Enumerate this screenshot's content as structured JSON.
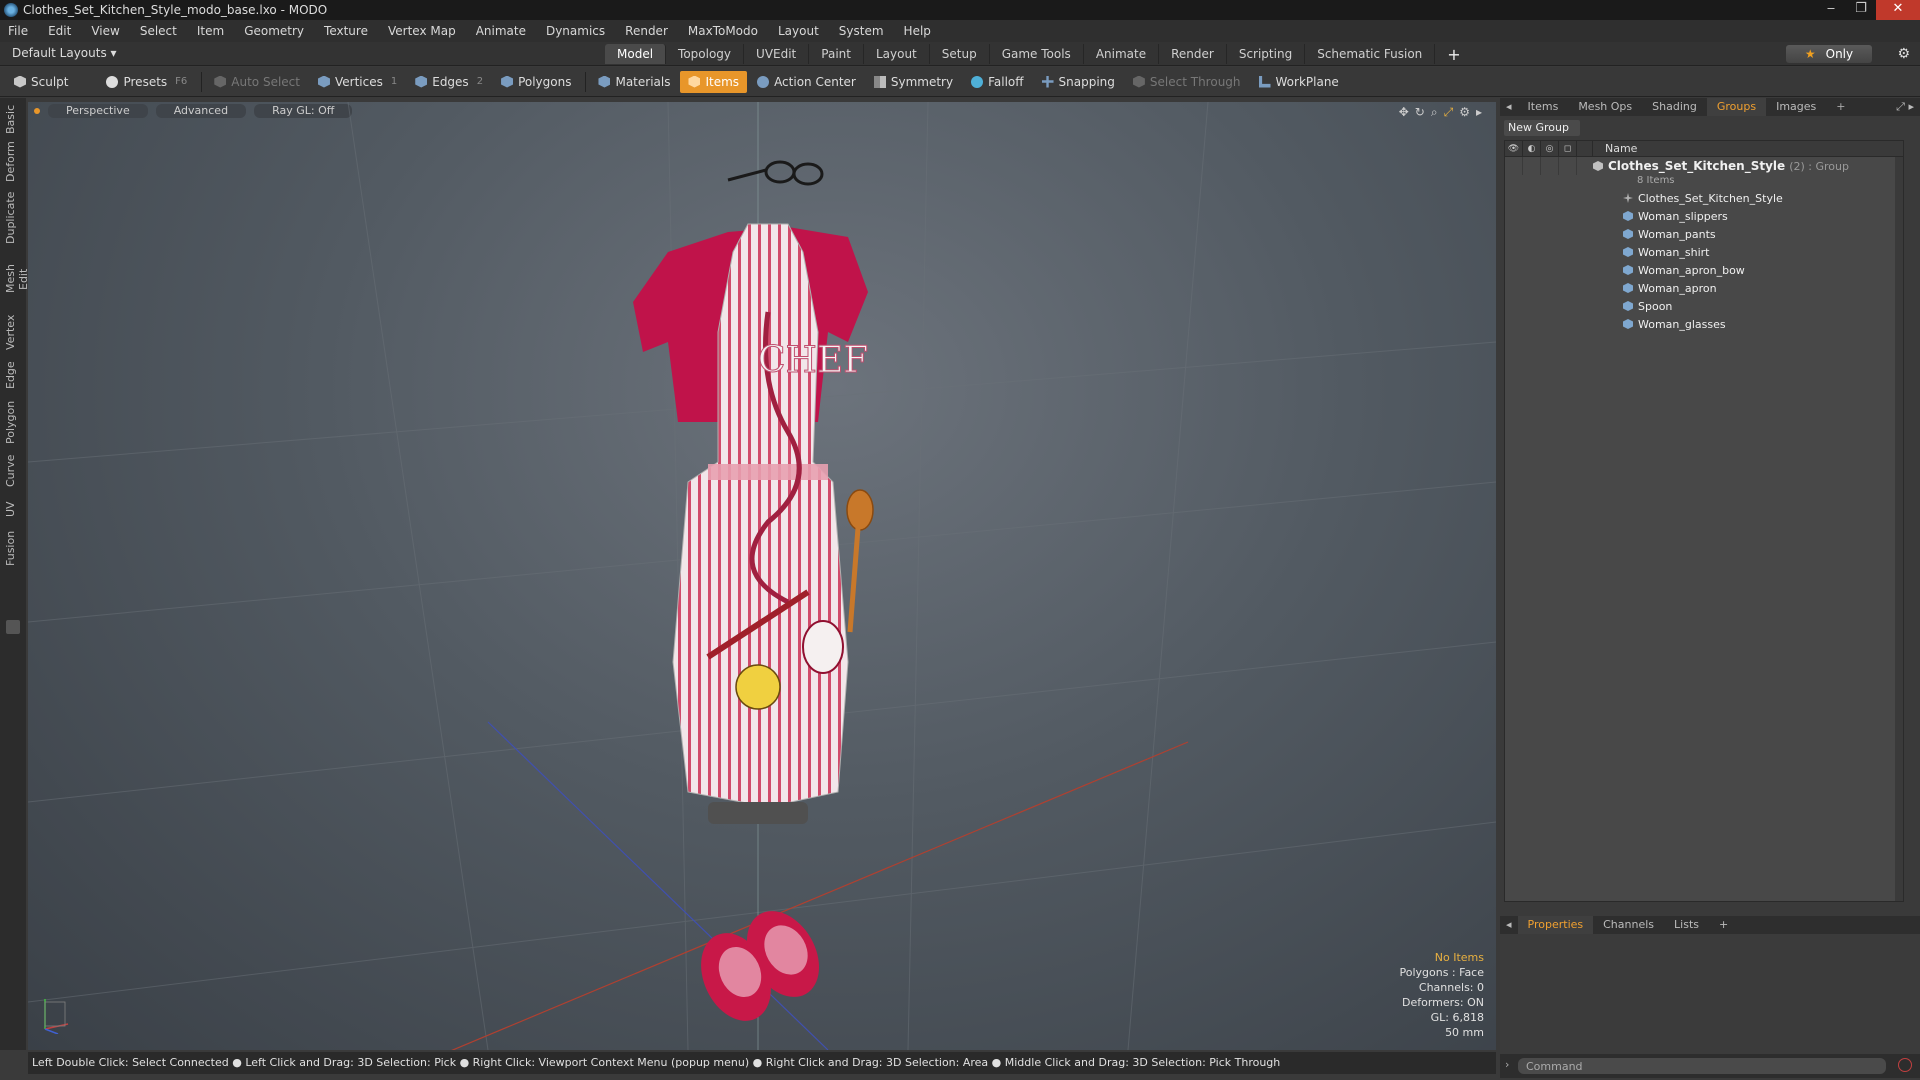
{
  "window": {
    "title": "Clothes_Set_Kitchen_Style_modo_base.lxo - MODO"
  },
  "menu": [
    "File",
    "Edit",
    "View",
    "Select",
    "Item",
    "Geometry",
    "Texture",
    "Vertex Map",
    "Animate",
    "Dynamics",
    "Render",
    "MaxToModo",
    "Layout",
    "System",
    "Help"
  ],
  "layouts": {
    "label": "Default Layouts ▾"
  },
  "tabs": [
    "Model",
    "Topology",
    "UVEdit",
    "Paint",
    "Layout",
    "Setup",
    "Game Tools",
    "Animate",
    "Render",
    "Scripting",
    "Schematic Fusion"
  ],
  "active_tab": "Model",
  "only_label": "Only",
  "toolbar": {
    "sculpt": "Sculpt",
    "presets": "Presets",
    "presets_key": "F6",
    "auto_select": "Auto Select",
    "vertices": "Vertices",
    "vertices_count": "1",
    "edges": "Edges",
    "edges_count": "2",
    "polygons": "Polygons",
    "materials": "Materials",
    "items": "Items",
    "action_center": "Action Center",
    "symmetry": "Symmetry",
    "falloff": "Falloff",
    "snapping": "Snapping",
    "select_through": "Select Through",
    "workplane": "WorkPlane"
  },
  "left_tabs": [
    "Basic",
    "Deform",
    "Duplicate",
    "Mesh Edit",
    "Vertex",
    "Edge",
    "Polygon",
    "Curve",
    "UV",
    "Fusion"
  ],
  "viewport": {
    "view": "Perspective",
    "shading": "Advanced",
    "raygl": "Ray GL: Off",
    "info": {
      "items": "No Items",
      "polygons": "Polygons : Face",
      "channels": "Channels: 0",
      "deformers": "Deformers: ON",
      "gl": "GL: 6,818",
      "focal": "50 mm"
    }
  },
  "status": "Left Double Click: Select Connected ● Left Click and Drag: 3D Selection: Pick ● Right Click: Viewport Context Menu (popup menu) ● Right Click and Drag: 3D Selection: Area ● Middle Click and Drag: 3D Selection: Pick Through",
  "panel": {
    "tabs": [
      "Items",
      "Mesh Ops",
      "Shading",
      "Groups",
      "Images"
    ],
    "active": "Groups",
    "new_group": "New Group",
    "column_name": "Name",
    "group": {
      "name": "Clothes_Set_Kitchen_Style",
      "suffix": "(2) : Group",
      "count": "8 Items"
    },
    "items": [
      "Clothes_Set_Kitchen_Style",
      "Woman_slippers",
      "Woman_pants",
      "Woman_shirt",
      "Woman_apron_bow",
      "Woman_apron",
      "Spoon",
      "Woman_glasses"
    ]
  },
  "properties": {
    "tabs": [
      "Properties",
      "Channels",
      "Lists"
    ],
    "active": "Properties"
  },
  "command": {
    "placeholder": "Command"
  },
  "colors": {
    "accent": "#e8962a",
    "active_tab": "#f0a030"
  }
}
